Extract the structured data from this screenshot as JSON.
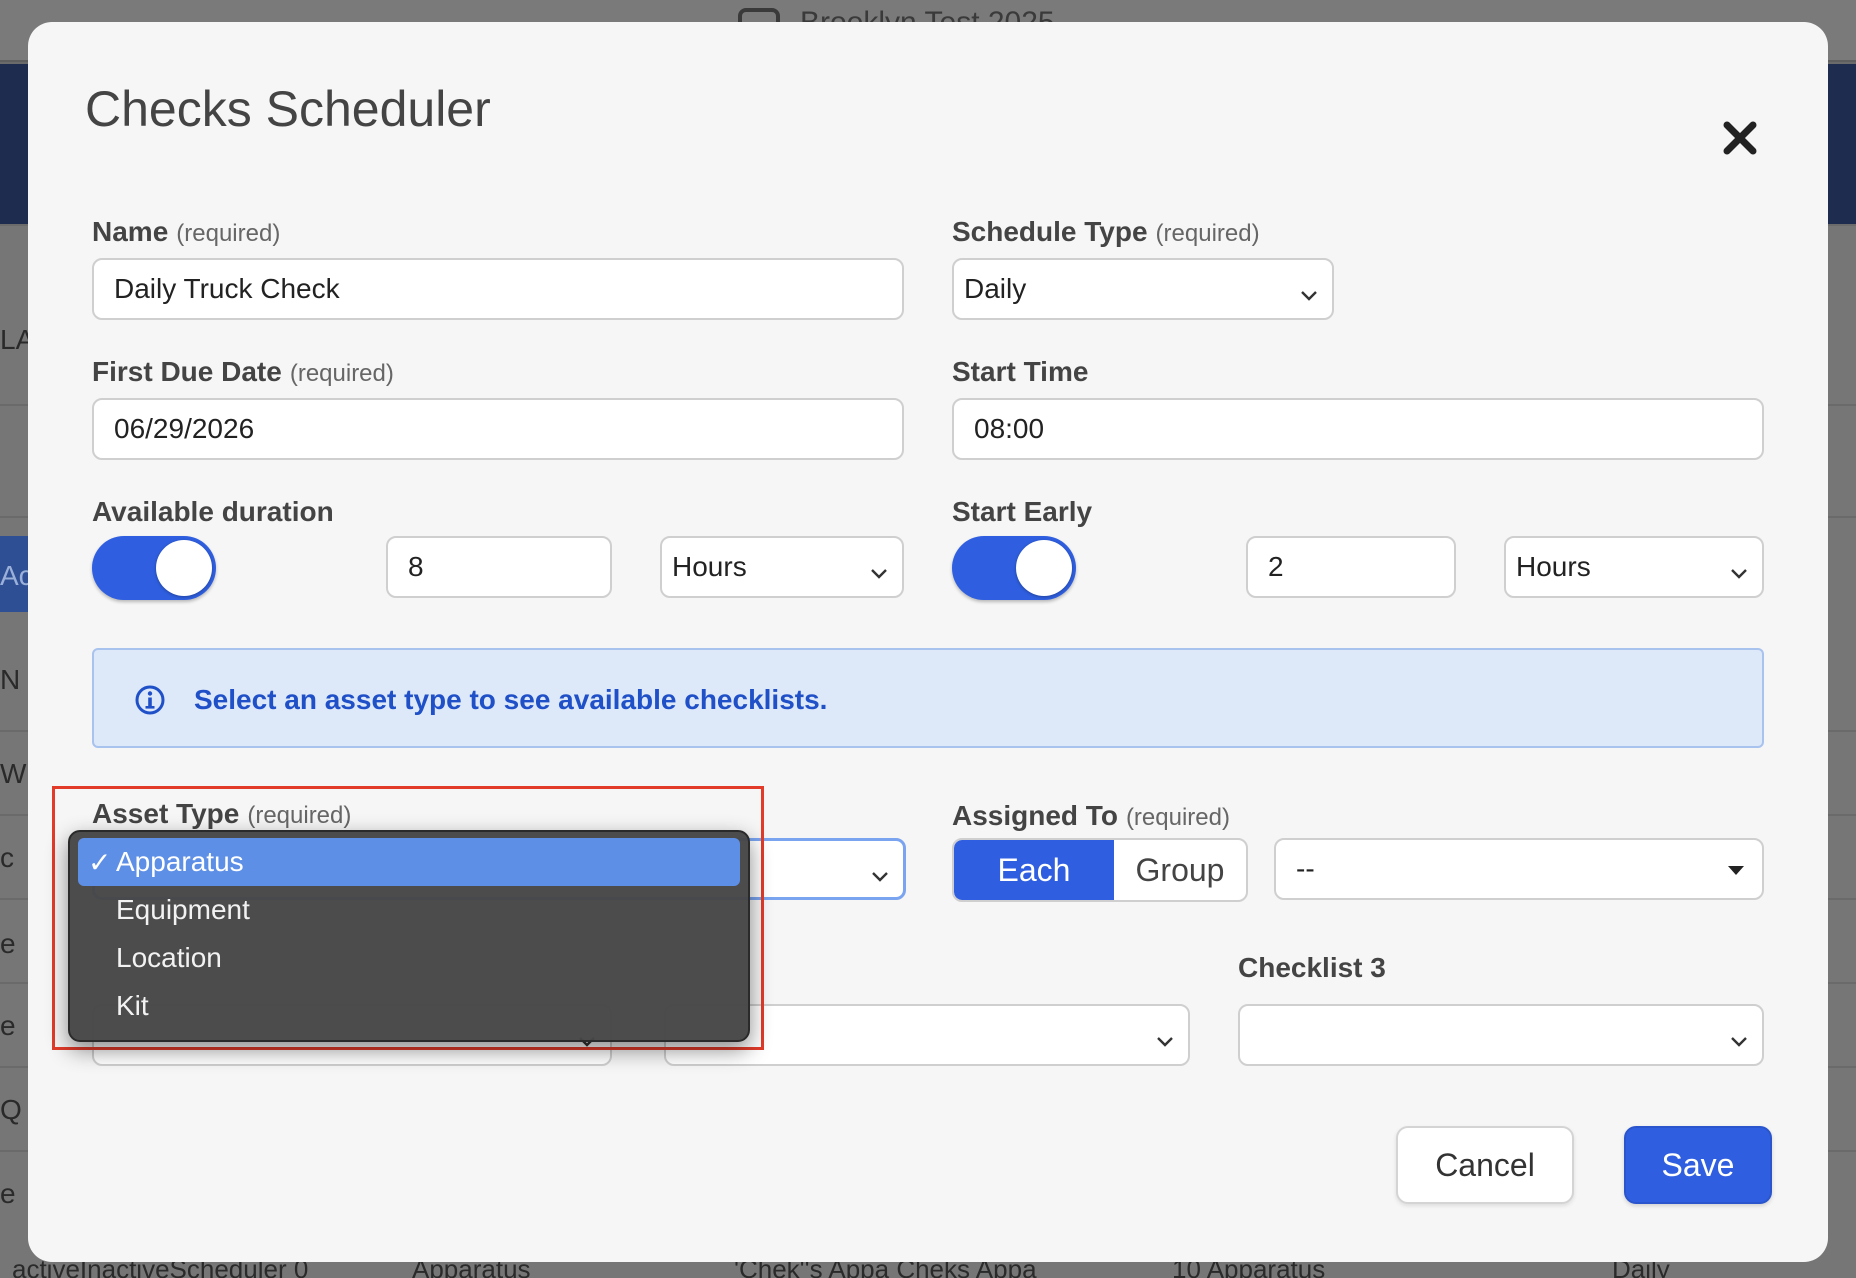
{
  "background": {
    "topbar_title": "Brooklyn Test 2025",
    "left_chars": [
      "LA",
      "Ac",
      "N",
      "W",
      "c",
      "e",
      "e",
      "Q",
      "e"
    ],
    "bottom_row": [
      "activeInactiveScheduler 0",
      "Apparatus",
      "'Chek''s Appa Cheks Appa",
      "10 Apparatus",
      "Daily"
    ]
  },
  "modal": {
    "title": "Checks Scheduler",
    "close_icon": "close-icon"
  },
  "form": {
    "required_hint": "(required)",
    "name": {
      "label": "Name",
      "value": "Daily Truck Check"
    },
    "schedule_type": {
      "label": "Schedule Type",
      "value": "Daily"
    },
    "first_due_date": {
      "label": "First Due Date",
      "value": "06/29/2026"
    },
    "start_time": {
      "label": "Start Time",
      "value": "08:00"
    },
    "available_duration": {
      "label": "Available duration",
      "enabled": true,
      "amount": "8",
      "unit": "Hours"
    },
    "start_early": {
      "label": "Start Early",
      "enabled": true,
      "amount": "2",
      "unit": "Hours"
    },
    "info": {
      "icon": "info-icon",
      "text": "Select an asset type to see available checklists."
    },
    "asset_type": {
      "label": "Asset Type",
      "options": [
        "Apparatus",
        "Equipment",
        "Location",
        "Kit"
      ],
      "selected": "Apparatus",
      "check_glyph": "✓"
    },
    "assigned_to": {
      "label": "Assigned To",
      "segments": [
        "Each",
        "Group"
      ],
      "active_segment": "Each",
      "assignee_value": "--"
    },
    "checklist_3": {
      "label": "Checklist 3",
      "value": ""
    }
  },
  "actions": {
    "cancel_label": "Cancel",
    "save_label": "Save"
  },
  "colors": {
    "primary": "#2f5fe0",
    "info_bg": "#dde8f9",
    "info_text": "#2050c8",
    "highlight": "#e23b2a"
  }
}
